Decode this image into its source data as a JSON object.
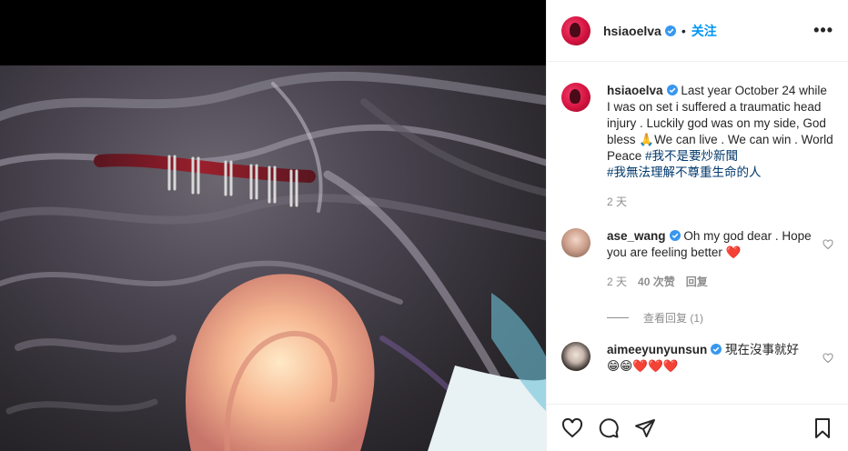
{
  "post": {
    "author": "hsiaoelva",
    "separator": "•",
    "follow_label": "关注",
    "more_label": "•••"
  },
  "caption": {
    "author": "hsiaoelva",
    "text": "Last year October 24 while I was on set i suffered a traumatic head injury . Luckily god was on my side, God bless 🙏We can live . We can win . World Peace ",
    "hashtag1": "#我不是要炒新聞",
    "hashtag2": "#我無法理解不尊重生命的人",
    "time": "2 天"
  },
  "comments": [
    {
      "author": "ase_wang",
      "text": "Oh my god dear . Hope you are feeling better ❤️",
      "time": "2 天",
      "likes": "40 次赞",
      "reply": "回复",
      "view_replies": "查看回复 (1)"
    },
    {
      "author": "aimeeyunyunsun",
      "text": "現在沒事就好",
      "emoji": "😁😁❤️❤️❤️"
    }
  ],
  "icons": [
    "heart-icon",
    "comment-icon",
    "share-icon",
    "save-icon",
    "verified-icon",
    "more-icon"
  ],
  "colors": {
    "link": "#0095f6",
    "hashtag": "#00376b",
    "muted": "#8e8e8e",
    "verified": "#3897f0"
  }
}
